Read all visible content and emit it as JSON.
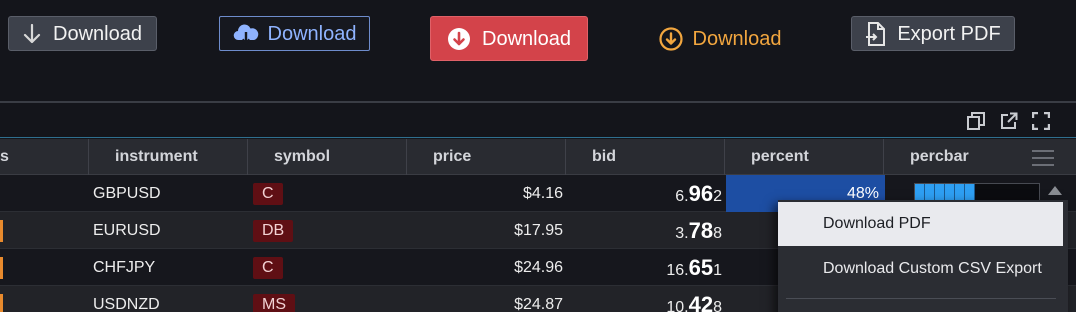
{
  "toolbar": {
    "download_gray": {
      "label": "Download",
      "icon": "arrow-down-icon"
    },
    "download_outline": {
      "label": "Download",
      "icon": "cloud-download-icon"
    },
    "download_red": {
      "label": "Download",
      "icon": "circle-arrow-down-icon"
    },
    "download_orange": {
      "label": "Download",
      "icon": "circle-arrow-down-outline-icon"
    },
    "export_pdf": {
      "label": "Export PDF",
      "icon": "file-export-icon"
    }
  },
  "panel_tools": [
    "restore-window-icon",
    "open-external-icon",
    "fullscreen-icon"
  ],
  "grid": {
    "columns": [
      "s",
      "instrument",
      "symbol",
      "price",
      "bid",
      "percent",
      "percbar"
    ],
    "rows": [
      {
        "instrument": "GBPUSD",
        "symbol": "C",
        "price": "$4.16",
        "bid_pre": "6.",
        "bid_big": "96",
        "bid_post": "2",
        "percent": "48%",
        "percbar": 0.48
      },
      {
        "instrument": "EURUSD",
        "symbol": "DB",
        "price": "$17.95",
        "bid_pre": "3.",
        "bid_big": "78",
        "bid_post": "8"
      },
      {
        "instrument": "CHFJPY",
        "symbol": "C",
        "price": "$24.96",
        "bid_pre": "16.",
        "bid_big": "65",
        "bid_post": "1"
      },
      {
        "instrument": "USDNZD",
        "symbol": "MS",
        "price": "$24.87",
        "bid_pre": "10.",
        "bid_big": "42",
        "bid_post": "8"
      }
    ]
  },
  "context_menu": {
    "items": [
      "Download PDF",
      "Download Custom CSV Export"
    ]
  },
  "colors": {
    "background": "#14151b",
    "red_button": "#d3434a",
    "orange_accent": "#f2a63f",
    "blue_link": "#8fb3ff",
    "percent_highlight": "#1d4ea3",
    "percbar_fill": "#2e9ff3",
    "symbol_tag": "#5f0f14"
  }
}
